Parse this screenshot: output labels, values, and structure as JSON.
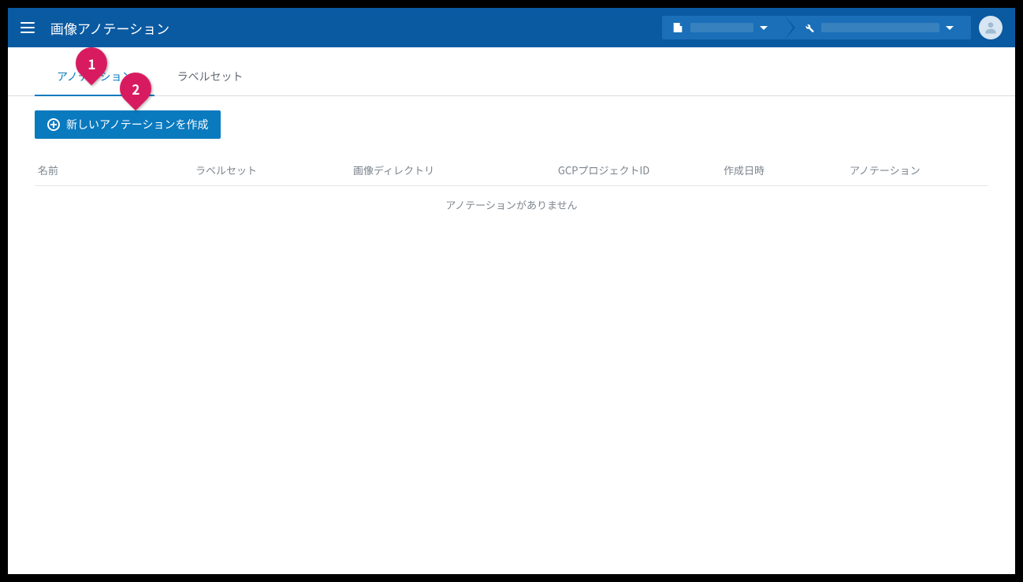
{
  "header": {
    "title": "画像アノテーション",
    "crumb1_icon": "building-icon",
    "crumb2_icon": "wrench-icon"
  },
  "tabs": {
    "annotation": "アノテーション",
    "labelset": "ラベルセット"
  },
  "actions": {
    "create_annotation": "新しいアノテーションを作成"
  },
  "table": {
    "columns": {
      "name": "名前",
      "labelset": "ラベルセット",
      "image_dir": "画像ディレクトリ",
      "gcp_project": "GCPプロジェクトID",
      "created_at": "作成日時",
      "annotation": "アノテーション"
    },
    "empty": "アノテーションがありません"
  },
  "callouts": {
    "c1": "1",
    "c2": "2"
  }
}
